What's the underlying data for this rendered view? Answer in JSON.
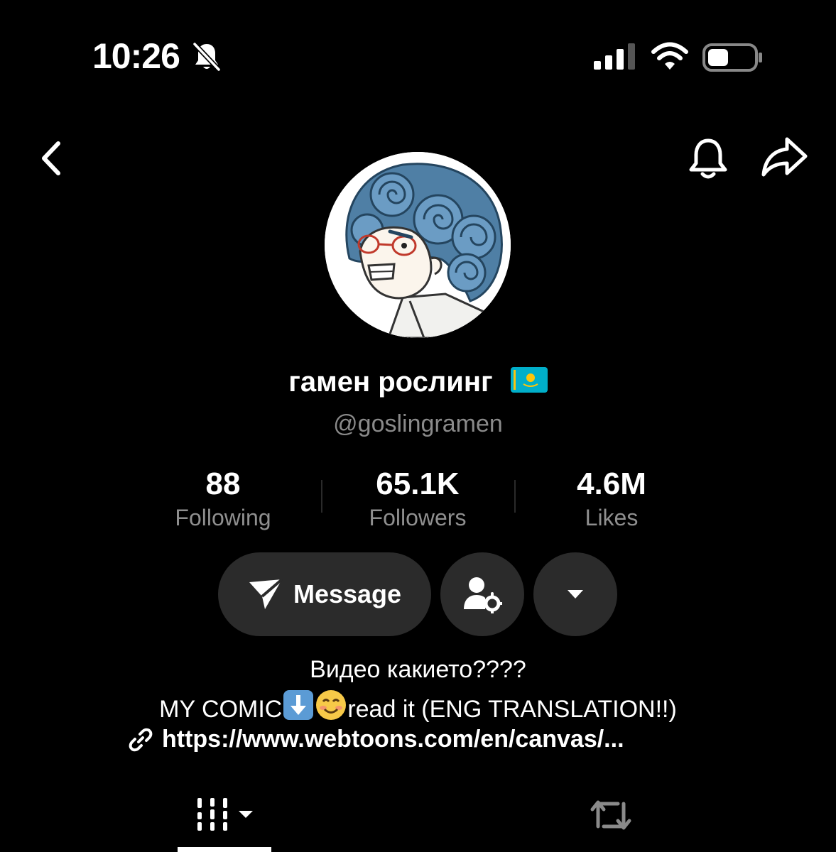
{
  "status_bar": {
    "time": "10:26",
    "icons": [
      "bell-slash-icon",
      "cellular-signal-icon",
      "wifi-icon",
      "battery-icon"
    ]
  },
  "nav": {
    "icons": [
      "back-icon",
      "bell-icon",
      "share-icon"
    ]
  },
  "profile": {
    "display_name": "гамен рослинг",
    "flag": "🇰🇿",
    "username": "@goslingramen"
  },
  "stats": {
    "following": {
      "value": "88",
      "label": "Following"
    },
    "followers": {
      "value": "65.1K",
      "label": "Followers"
    },
    "likes": {
      "value": "4.6M",
      "label": "Likes"
    }
  },
  "actions": {
    "message_label": "Message",
    "icons": [
      "send-icon",
      "user-settings-icon",
      "chevron-down-icon"
    ]
  },
  "bio": {
    "line1": "Видео какието????",
    "line2_prefix": "MY COMIC",
    "line2_emojis": [
      "⬇️",
      "😊"
    ],
    "line2_suffix": "read it (ENG TRANSLATION!!)",
    "link": "https://www.webtoons.com/en/canvas/..."
  },
  "tabs": {
    "icons": [
      "videos-grid-icon",
      "reposts-icon"
    ],
    "active": "videos"
  },
  "colors": {
    "background": "#000000",
    "button_bg": "#2b2b2b",
    "muted_text": "#8f8f8f",
    "flag_blue": "#00AFCA",
    "flag_yellow": "#FEC50C"
  }
}
